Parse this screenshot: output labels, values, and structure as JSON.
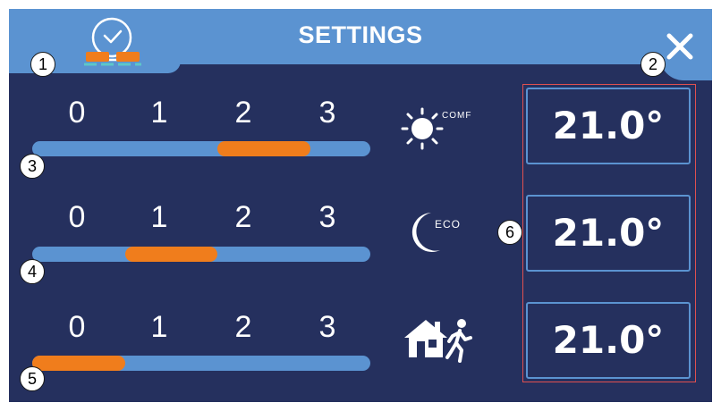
{
  "header": {
    "title": "SETTINGS"
  },
  "markers": [
    "1",
    "2",
    "3",
    "4",
    "5",
    "6"
  ],
  "sliders": [
    {
      "labels": [
        "0",
        "1",
        "2",
        "3"
      ],
      "range_start": 2,
      "range_end": 3
    },
    {
      "labels": [
        "0",
        "1",
        "2",
        "3"
      ],
      "range_start": 1,
      "range_end": 2
    },
    {
      "labels": [
        "0",
        "1",
        "2",
        "3"
      ],
      "range_start": 0,
      "range_end": 1
    }
  ],
  "modes": [
    {
      "icon": "sun-icon",
      "label": "COMF"
    },
    {
      "icon": "moon-icon",
      "label": "ECO"
    },
    {
      "icon": "house-away-icon",
      "label": ""
    }
  ],
  "temps": [
    "21.0°",
    "21.0°",
    "21.0°"
  ],
  "colors": {
    "background": "#25305e",
    "header": "#5b93d1",
    "track": "#5b93d1",
    "active_range": "#f07d1c",
    "highlight_box": "#e05050",
    "text": "#ffffff"
  }
}
